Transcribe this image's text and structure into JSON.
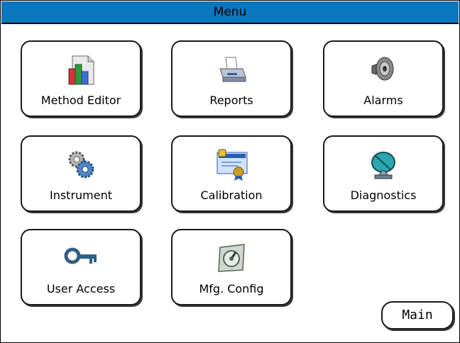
{
  "window": {
    "title": "Menu"
  },
  "tiles": [
    {
      "label": "Method Editor",
      "icon": "method-editor-icon"
    },
    {
      "label": "Reports",
      "icon": "printer-icon"
    },
    {
      "label": "Alarms",
      "icon": "speaker-icon"
    },
    {
      "label": "Instrument",
      "icon": "gears-icon"
    },
    {
      "label": "Calibration",
      "icon": "certificate-icon"
    },
    {
      "label": "Diagnostics",
      "icon": "satellite-dish-icon"
    },
    {
      "label": "User Access",
      "icon": "key-icon"
    },
    {
      "label": "Mfg. Config",
      "icon": "dial-icon"
    }
  ],
  "footer": {
    "main_label": "Main"
  },
  "colors": {
    "titlebar": "#0a76bd"
  }
}
